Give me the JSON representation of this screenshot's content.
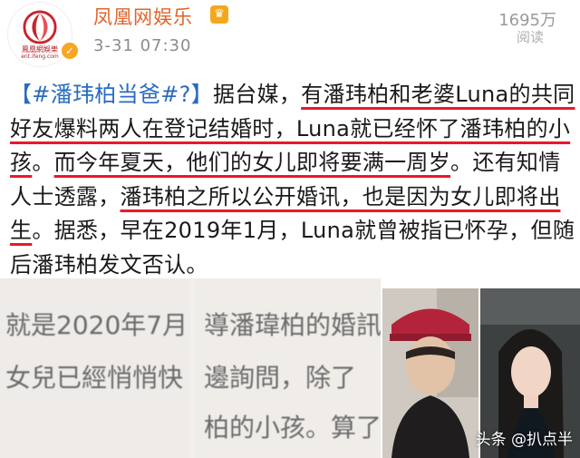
{
  "account": {
    "name": "凤凰网娱乐",
    "logo_text_cn": "鳳凰網娛樂",
    "logo_text_en": "ent.ifeng.com",
    "timestamp": "3-31 07:30",
    "read_count": "1695万",
    "read_label": "阅读"
  },
  "post": {
    "hashtag": "【#潘玮柏当爸#?】",
    "s1": "据台媒，",
    "s2": "有潘玮柏和老婆Luna的共同好友爆料两人在登记结婚时，Luna就已经怀了潘玮柏的小孩",
    "s3": "。",
    "s4": "而今年夏天，他们的女儿即将要满一周岁",
    "s5": "。还有知情人士透露，",
    "s6": "潘玮柏之所以公开婚讯，也是因为女儿即将出生",
    "s7": "。据悉，早在2019年1月，Luna就曾被指已怀孕，但随后潘玮柏发文否认。"
  },
  "image": {
    "line1a": "就是2020年7月",
    "line1b": "導潘瑋柏的婚訊",
    "line2a": "女兒已經悄悄快",
    "line2b": "邊詢問，除了",
    "line3b": "柏的小孩。算了"
  },
  "watermark": "头条 @扒点半"
}
